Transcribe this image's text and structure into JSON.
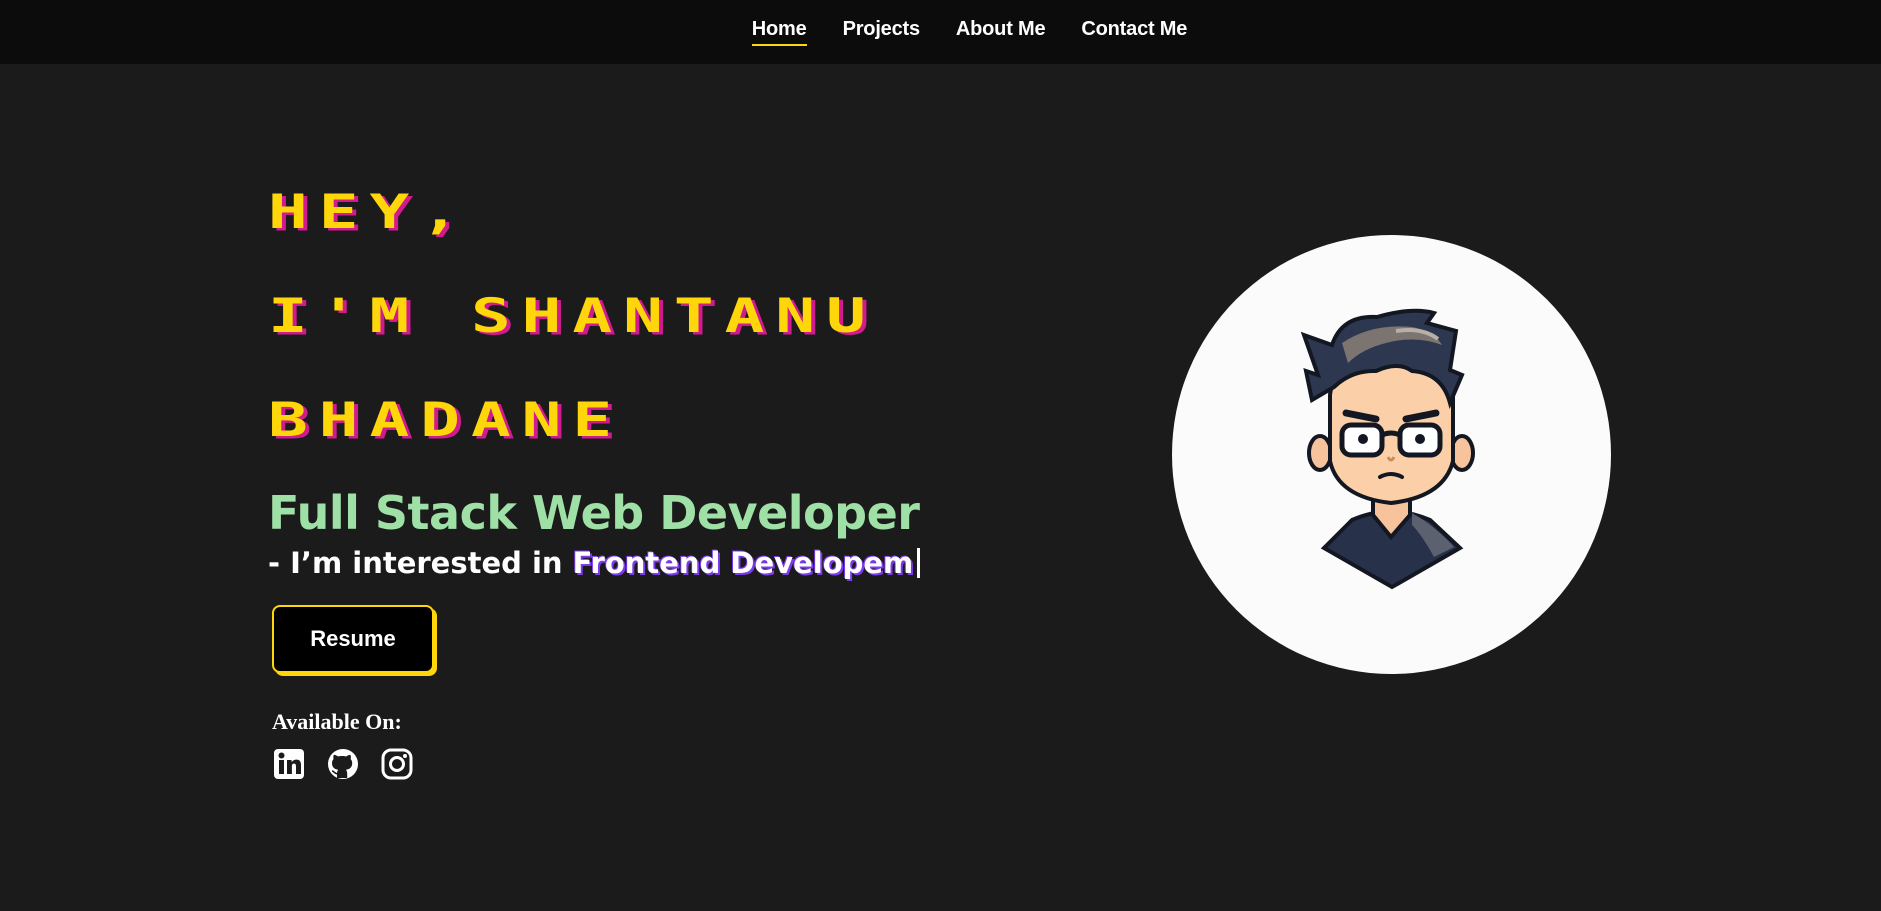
{
  "nav": {
    "items": [
      {
        "label": "Home",
        "active": true
      },
      {
        "label": "Projects",
        "active": false
      },
      {
        "label": "About Me",
        "active": false
      },
      {
        "label": "Contact Me",
        "active": false
      }
    ]
  },
  "hero": {
    "greeting_line1": "HEY,",
    "greeting_line2": "I'M SHANTANU",
    "greeting_line3": "BHADANE",
    "role": "Full Stack Web Developer",
    "interest_prefix": "- I’m interested in",
    "interest_typed": "Frontend Developem",
    "resume_label": "Resume",
    "available_label": "Available On:",
    "socials": [
      {
        "name": "linkedin-icon"
      },
      {
        "name": "github-icon"
      },
      {
        "name": "instagram-icon"
      }
    ],
    "avatar": "cartoon-avatar"
  },
  "colors": {
    "page_background": "#1b1b1b",
    "navbar_background": "#0c0c0c",
    "accent_yellow": "#ffd60a",
    "shadow_pink": "#d11a8f",
    "role_green": "#9fe0a6",
    "typed_outline_purple": "#7c3aed",
    "avatar_background": "#fbfbfb"
  }
}
